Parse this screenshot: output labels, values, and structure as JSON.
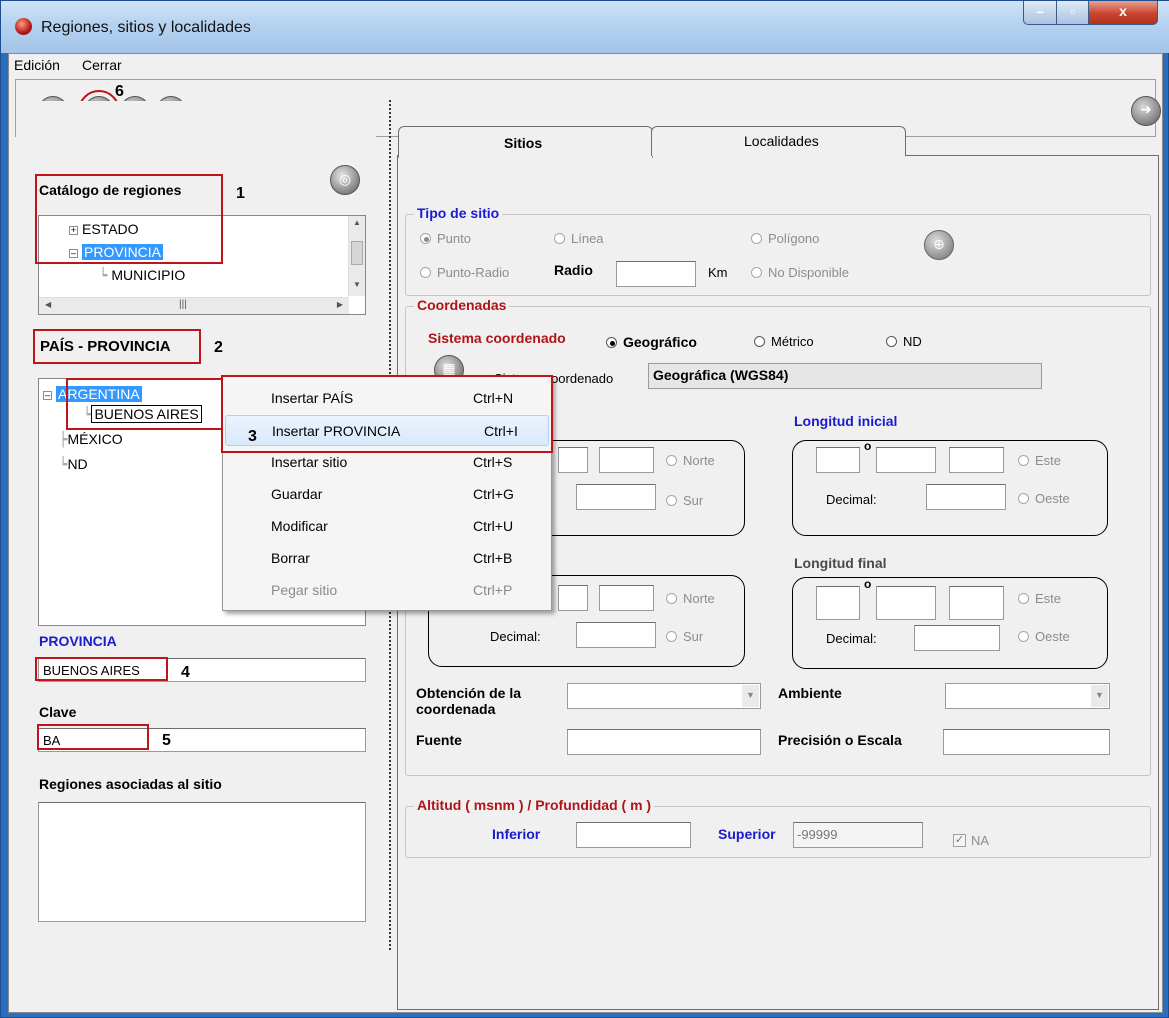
{
  "window": {
    "title": "Regiones, sitios y localidades",
    "close_glyph": "x"
  },
  "menu": {
    "edicion": "Edición",
    "cerrar": "Cerrar"
  },
  "toolbar": {
    "annotation": "6"
  },
  "catalog": {
    "title": "Catálogo de regiones",
    "annotation": "1",
    "items": [
      "ESTADO",
      "PROVINCIA",
      "MUNICIPIO"
    ]
  },
  "path": {
    "text": "PAÍS - PROVINCIA",
    "annotation": "2"
  },
  "tree2": {
    "items": [
      "ARGENTINA",
      "BUENOS AIRES",
      "MÉXICO",
      "ND"
    ]
  },
  "context_menu": {
    "annotation": "3",
    "items": [
      {
        "label": "Insertar PAÍS",
        "key": "Ctrl+N"
      },
      {
        "label": "Insertar PROVINCIA",
        "key": "Ctrl+I"
      },
      {
        "label": "Insertar sitio",
        "key": "Ctrl+S"
      },
      {
        "label": "Guardar",
        "key": "Ctrl+G"
      },
      {
        "label": "Modificar",
        "key": "Ctrl+U"
      },
      {
        "label": "Borrar",
        "key": "Ctrl+B"
      },
      {
        "label": "Pegar sitio",
        "key": "Ctrl+P"
      }
    ]
  },
  "left_form": {
    "provincia_label": "PROVINCIA",
    "provincia_value": "BUENOS AIRES",
    "provincia_annotation": "4",
    "clave_label": "Clave",
    "clave_value": "BA",
    "clave_annotation": "5",
    "regiones_label": "Regiones asociadas al sitio"
  },
  "tabs": {
    "sitios": "Sitios",
    "localidades": "Localidades"
  },
  "tipo_sitio": {
    "title": "Tipo de sitio",
    "punto": "Punto",
    "linea": "Línea",
    "poligono": "Polígono",
    "punto_radio": "Punto-Radio",
    "radio_label": "Radio",
    "km": "Km",
    "no_disponible": "No Disponible"
  },
  "coordenadas": {
    "title": "Coordenadas",
    "sistema_label": "Sistema coordenado",
    "geografico": "Geográfico",
    "metrico": "Métrico",
    "nd": "ND",
    "sistema_caption": "Sistema coordenado",
    "sistema_value": "Geográfica (WGS84)",
    "longitud_inicial": "Longitud inicial",
    "longitud_final": "Longitud final",
    "norte": "Norte",
    "sur": "Sur",
    "este": "Este",
    "oeste": "Oeste",
    "decimal": "Decimal:",
    "deg": "o",
    "obtencion": "Obtención de la coordenada",
    "ambiente": "Ambiente",
    "fuente": "Fuente",
    "precision": "Precisión o Escala"
  },
  "altitud": {
    "title": "Altitud ( msnm ) / Profundidad ( m )",
    "inferior": "Inferior",
    "superior": "Superior",
    "superior_value": "-99999",
    "na": "NA"
  },
  "colors": {
    "annotation_red": "#c0141c",
    "selection_blue": "#3399ff",
    "label_blue": "#1a1ad0",
    "label_red": "#b01418"
  }
}
